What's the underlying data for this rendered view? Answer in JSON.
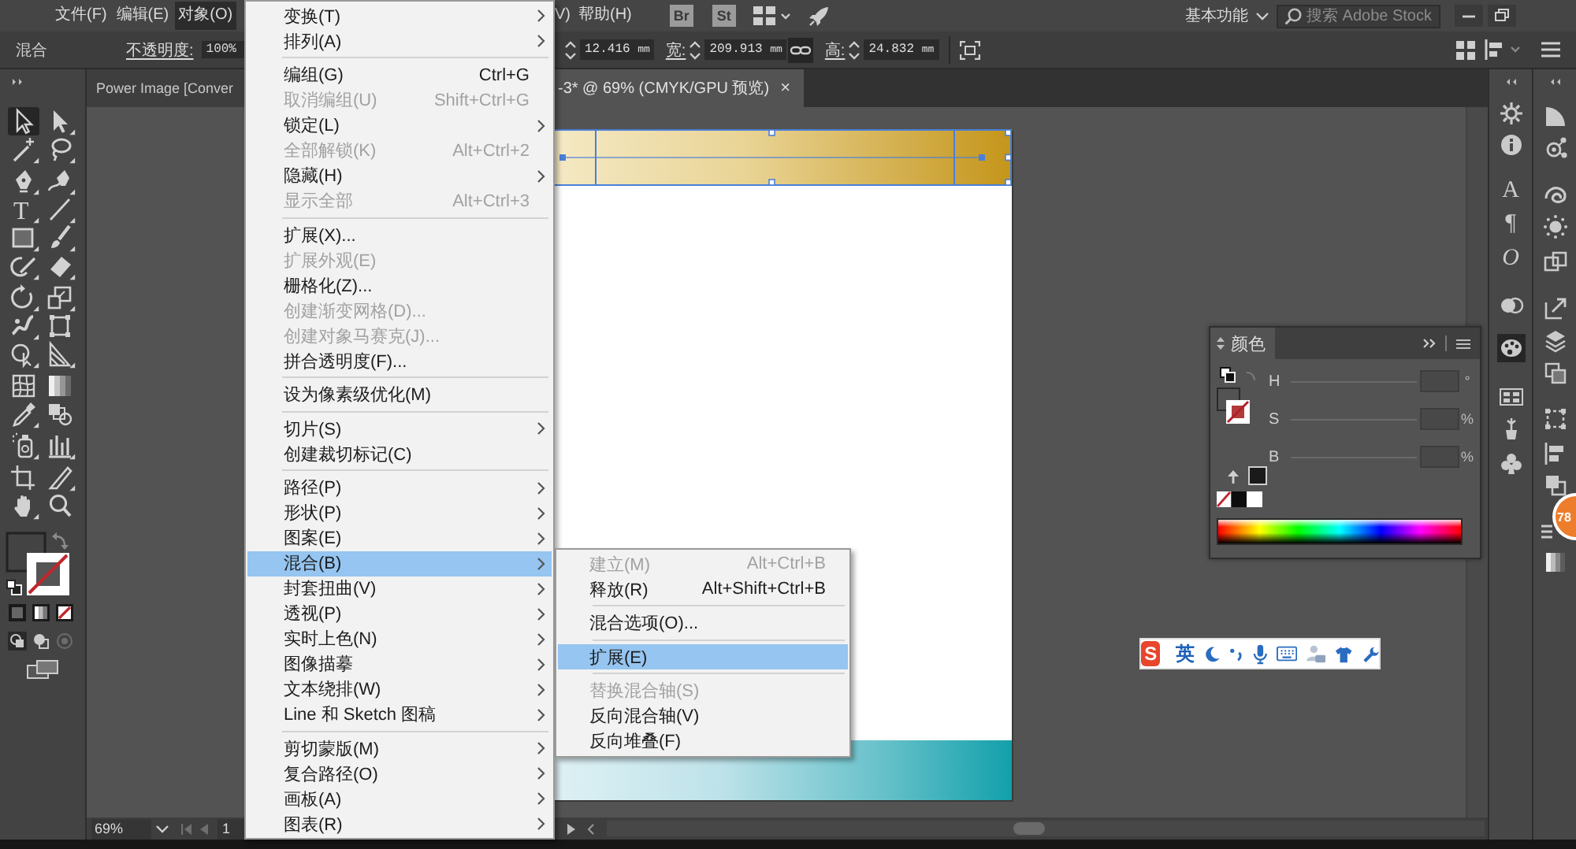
{
  "menu_bar": {
    "items": [
      {
        "label": "文件(F)",
        "selected": false
      },
      {
        "label": "编辑(E)",
        "selected": false
      },
      {
        "label": "对象(O)",
        "selected": true
      }
    ],
    "items_right_of_menu": [
      {
        "label": "V)",
        "selected": false
      },
      {
        "label": "帮助(H)",
        "selected": false
      }
    ],
    "app_buttons": [
      "Br",
      "St"
    ],
    "workspace": "基本功能",
    "search": {
      "placeholder": "搜索 Adobe Stock"
    }
  },
  "control_bar": {
    "selection_label": "混合",
    "opacity_label": "不透明度:",
    "opacity_value": "100%",
    "unlabeled_field": {
      "value": "12.416",
      "unit": "mm"
    },
    "width": {
      "label": "宽:",
      "value": "209.913",
      "unit": "mm"
    },
    "height": {
      "label": "高:",
      "value": "24.832",
      "unit": "mm"
    }
  },
  "document_tabs": [
    {
      "label": "Power Image [Conver",
      "selected": false
    },
    {
      "label": "-3* @ 69% (CMYK/GPU 预览)",
      "selected": true,
      "close": "×"
    }
  ],
  "tools": [
    {
      "selected": true
    },
    {
      "selected": false
    },
    {
      "selected": false
    },
    {
      "selected": false
    },
    {
      "selected": false
    },
    {
      "selected": false
    },
    {
      "glyph": "T",
      "selected": false
    },
    {
      "selected": false
    },
    {
      "selected": false
    },
    {
      "selected": false
    },
    {
      "selected": false
    },
    {
      "selected": false
    },
    {
      "selected": false
    },
    {
      "selected": false
    },
    {
      "selected": false
    },
    {
      "selected": false
    },
    {
      "selected": false
    },
    {
      "selected": false
    },
    {
      "selected": false
    },
    {
      "selected": false
    },
    {
      "selected": false
    },
    {
      "selected": false
    },
    {
      "selected": false
    },
    {
      "selected": false
    },
    {
      "selected": false
    },
    {
      "selected": false
    },
    {
      "selected": false
    },
    {
      "selected": false
    }
  ],
  "object_menu": {
    "groups": [
      [
        {
          "label": "变换(T)",
          "submenu": true,
          "disabled": false,
          "selected": false
        },
        {
          "label": "排列(A)",
          "submenu": true,
          "disabled": false,
          "selected": false
        }
      ],
      [
        {
          "label": "编组(G)",
          "shortcut": "Ctrl+G",
          "submenu": false,
          "disabled": false,
          "selected": false
        },
        {
          "label": "取消编组(U)",
          "shortcut": "Shift+Ctrl+G",
          "submenu": false,
          "disabled": true,
          "selected": false
        },
        {
          "label": "锁定(L)",
          "submenu": true,
          "disabled": false,
          "selected": false
        },
        {
          "label": "全部解锁(K)",
          "shortcut": "Alt+Ctrl+2",
          "submenu": false,
          "disabled": true,
          "selected": false
        },
        {
          "label": "隐藏(H)",
          "submenu": true,
          "disabled": false,
          "selected": false
        },
        {
          "label": "显示全部",
          "shortcut": "Alt+Ctrl+3",
          "submenu": false,
          "disabled": true,
          "selected": false
        }
      ],
      [
        {
          "label": "扩展(X)...",
          "submenu": false,
          "disabled": false,
          "selected": false
        },
        {
          "label": "扩展外观(E)",
          "submenu": false,
          "disabled": true,
          "selected": false
        },
        {
          "label": "栅格化(Z)...",
          "submenu": false,
          "disabled": false,
          "selected": false
        },
        {
          "label": "创建渐变网格(D)...",
          "submenu": false,
          "disabled": true,
          "selected": false
        },
        {
          "label": "创建对象马赛克(J)...",
          "submenu": false,
          "disabled": true,
          "selected": false
        },
        {
          "label": "拼合透明度(F)...",
          "submenu": false,
          "disabled": false,
          "selected": false
        }
      ],
      [
        {
          "label": "设为像素级优化(M)",
          "submenu": false,
          "disabled": false,
          "selected": false
        }
      ],
      [
        {
          "label": "切片(S)",
          "submenu": true,
          "disabled": false,
          "selected": false
        },
        {
          "label": "创建裁切标记(C)",
          "submenu": false,
          "disabled": false,
          "selected": false
        }
      ],
      [
        {
          "label": "路径(P)",
          "submenu": true,
          "disabled": false,
          "selected": false
        },
        {
          "label": "形状(P)",
          "submenu": true,
          "disabled": false,
          "selected": false
        },
        {
          "label": "图案(E)",
          "submenu": true,
          "disabled": false,
          "selected": false
        },
        {
          "label": "混合(B)",
          "submenu": true,
          "disabled": false,
          "selected": true
        },
        {
          "label": "封套扭曲(V)",
          "submenu": true,
          "disabled": false,
          "selected": false
        },
        {
          "label": "透视(P)",
          "submenu": true,
          "disabled": false,
          "selected": false
        },
        {
          "label": "实时上色(N)",
          "submenu": true,
          "disabled": false,
          "selected": false
        },
        {
          "label": "图像描摹",
          "submenu": true,
          "disabled": false,
          "selected": false
        },
        {
          "label": "文本绕排(W)",
          "submenu": true,
          "disabled": false,
          "selected": false
        },
        {
          "label": "Line 和 Sketch 图稿",
          "submenu": true,
          "disabled": false,
          "selected": false
        }
      ],
      [
        {
          "label": "剪切蒙版(M)",
          "submenu": true,
          "disabled": false,
          "selected": false
        },
        {
          "label": "复合路径(O)",
          "submenu": true,
          "disabled": false,
          "selected": false
        },
        {
          "label": "画板(A)",
          "submenu": true,
          "disabled": false,
          "selected": false
        },
        {
          "label": "图表(R)",
          "submenu": true,
          "disabled": false,
          "selected": false
        }
      ]
    ]
  },
  "blend_submenu": {
    "groups": [
      [
        {
          "label": "建立(M)",
          "shortcut": "Alt+Ctrl+B",
          "disabled": true,
          "selected": false
        },
        {
          "label": "释放(R)",
          "shortcut": "Alt+Shift+Ctrl+B",
          "disabled": false,
          "selected": false
        }
      ],
      [
        {
          "label": "混合选项(O)...",
          "disabled": false,
          "selected": false
        }
      ],
      [
        {
          "label": "扩展(E)",
          "disabled": false,
          "selected": true
        }
      ],
      [
        {
          "label": "替换混合轴(S)",
          "disabled": true,
          "selected": false
        },
        {
          "label": "反向混合轴(V)",
          "disabled": false,
          "selected": false
        },
        {
          "label": "反向堆叠(F)",
          "disabled": false,
          "selected": false
        }
      ]
    ]
  },
  "canvas": {
    "blend_object": {
      "selected": true
    }
  },
  "status_bar": {
    "zoom": "69%",
    "page": "1"
  },
  "color_panel": {
    "title": "颜色",
    "channels": [
      {
        "name": "H",
        "unit": "°"
      },
      {
        "name": "S",
        "unit": "%"
      },
      {
        "name": "B",
        "unit": "%"
      }
    ]
  },
  "dock": {
    "column_1": [
      {
        "selected": false
      },
      {
        "selected": false
      },
      {
        "glyph": "A",
        "selected": false
      },
      {
        "glyph": "¶",
        "selected": false
      },
      {
        "glyph": "O",
        "selected": false
      },
      {
        "selected": false
      },
      {
        "selected": true
      },
      {
        "selected": false
      },
      {
        "selected": false
      },
      {
        "selected": false
      }
    ],
    "column_2": [
      {
        "selected": false
      },
      {
        "selected": false
      },
      {
        "selected": false
      },
      {
        "selected": false
      },
      {
        "selected": false
      },
      {
        "selected": false
      },
      {
        "selected": false
      },
      {
        "selected": false
      },
      {
        "selected": false
      },
      {
        "selected": false
      },
      {
        "selected": false
      },
      {
        "selected": false
      },
      {
        "selected": false
      }
    ]
  },
  "ime_bar": {
    "logo": "S",
    "mode": "英"
  },
  "badge": {
    "text": "78"
  }
}
